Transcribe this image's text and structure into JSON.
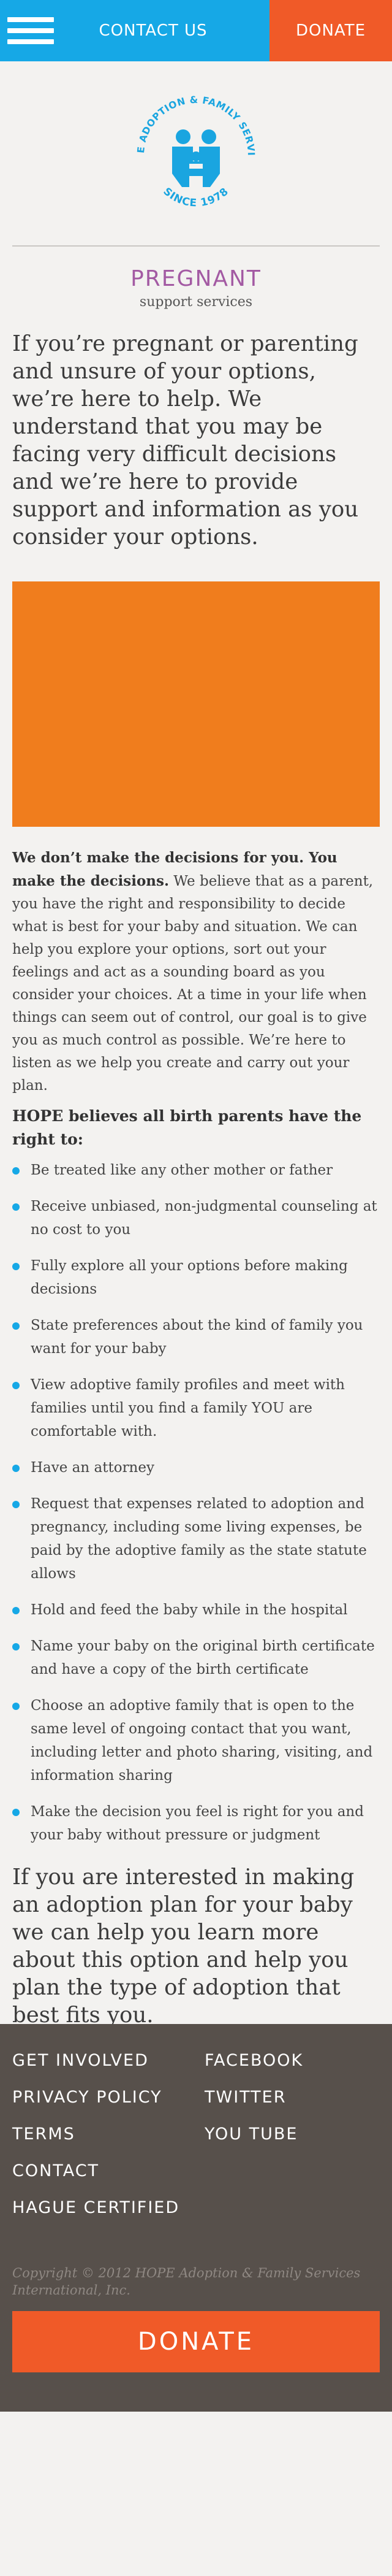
{
  "header": {
    "menu_icon": "hamburger-icon",
    "contact_label": "CONTACT US",
    "donate_label": "DONATE",
    "colors": {
      "bar": "#16a8e6",
      "donate": "#f05a28"
    }
  },
  "logo": {
    "arc_text": "HOPE ADOPTION & FAMILY SERVICES",
    "since_text": "SINCE 1978",
    "color": "#1aa5e0"
  },
  "page": {
    "title": "PREGNANT",
    "subtitle": "support services",
    "title_color": "#a35aa3",
    "intro": "If you’re pregnant or parenting and unsure of your options, we’re here to help. We understand that you may be facing very difficult decisions and we’re here to provide support and information as you consider your options.",
    "video_color": "#f07d1d",
    "body_lead": "We don’t make the decisions for you. You make the decisions.",
    "body_rest": " We believe that as a parent, you have the right and responsibility to decide what is best for your baby and situation. We can help you explore your options, sort out your feelings and act as a sounding board as you consider your choices. At a time in your life when things can seem out of control, our goal is to give you as much control as possible. We’re here to listen as we help you create and carry out your plan.",
    "rights_heading": "HOPE believes all birth parents have the right to:",
    "rights": [
      "Be treated like any other mother or father",
      "Receive unbiased, non-judgmental counseling at no cost to you",
      "Fully explore all your options before making decisions",
      "State preferences about the kind of family you want for your baby",
      "View adoptive family profiles and meet with families until you find a family YOU are comfortable with.",
      "Have an attorney",
      "Request that expenses related to adoption and pregnancy, including some living expenses, be paid by the adoptive family as the state statute allows",
      "Hold and feed the baby while in the hospital",
      "Name your baby on the original birth certificate and have a copy of the birth certificate",
      "Choose an adoptive family that is open to the same level of ongoing contact that you want, including letter and photo sharing, visiting, and information sharing",
      "Make the decision you feel is right for you and your baby without pressure or judgment"
    ],
    "closing": "If you are interested in making an adoption plan for your baby we can help you learn more about this option and help you plan the type of adoption that best fits you."
  },
  "footer": {
    "links": [
      "GET INVOLVED",
      "FACEBOOK",
      "PRIVACY POLICY",
      "TWITTER",
      "TERMS",
      "YOU TUBE",
      "CONTACT",
      "",
      "HAGUE CERTIFIED",
      ""
    ],
    "copyright": "Copyright © 2012 HOPE Adoption & Family Services International, Inc.",
    "donate_label": "DONATE",
    "bg_color": "#57504b"
  }
}
